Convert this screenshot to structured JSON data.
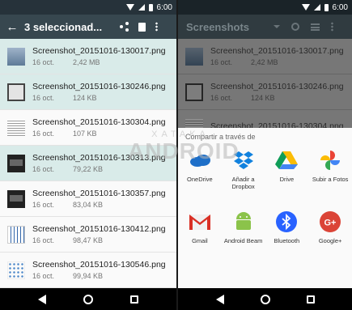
{
  "status": {
    "time": "6:00"
  },
  "left": {
    "toolbar": {
      "title": "3 seleccionad..."
    },
    "files": [
      {
        "name": "Screenshot_20151016-130017.png",
        "date": "16 oct.",
        "size": "2,42 MB",
        "selected": true,
        "thumb": "t-blue"
      },
      {
        "name": "Screenshot_20151016-130246.png",
        "date": "16 oct.",
        "size": "124 KB",
        "selected": true,
        "thumb": "t-frame"
      },
      {
        "name": "Screenshot_20151016-130304.png",
        "date": "16 oct.",
        "size": "107 KB",
        "selected": false,
        "thumb": "t-text"
      },
      {
        "name": "Screenshot_20151016-130313.png",
        "date": "16 oct.",
        "size": "79,22 KB",
        "selected": true,
        "thumb": "t-dark"
      },
      {
        "name": "Screenshot_20151016-130357.png",
        "date": "16 oct.",
        "size": "83,04 KB",
        "selected": false,
        "thumb": "t-dark"
      },
      {
        "name": "Screenshot_20151016-130412.png",
        "date": "16 oct.",
        "size": "98,47 KB",
        "selected": false,
        "thumb": "t-grid"
      },
      {
        "name": "Screenshot_20151016-130546.png",
        "date": "16 oct.",
        "size": "99,94 KB",
        "selected": false,
        "thumb": "t-dots"
      }
    ]
  },
  "right": {
    "toolbar": {
      "title": "Screenshots"
    },
    "files": [
      {
        "name": "Screenshot_20151016-130017.png",
        "date": "16 oct.",
        "size": "2,42 MB",
        "thumb": "t-blue"
      },
      {
        "name": "Screenshot_20151016-130246.png",
        "date": "16 oct.",
        "size": "124 KB",
        "thumb": "t-frame"
      },
      {
        "name": "Screenshot_20151016-130304.png",
        "date": "",
        "size": "",
        "thumb": "t-text"
      }
    ],
    "share": {
      "title": "Compartir a través de",
      "apps": [
        {
          "label": "OneDrive",
          "icon": "onedrive-icon",
          "color": "#1e6fc8"
        },
        {
          "label": "Añadir a Dropbox",
          "icon": "dropbox-icon",
          "color": "#1081de"
        },
        {
          "label": "Drive",
          "icon": "drive-icon",
          "color": "#fbbc05"
        },
        {
          "label": "Subir a Fotos",
          "icon": "photos-icon",
          "color": "#ea4335"
        },
        {
          "label": "Gmail",
          "icon": "gmail-icon",
          "color": "#d93025"
        },
        {
          "label": "Android Beam",
          "icon": "android-beam-icon",
          "color": "#8bc34a"
        },
        {
          "label": "Bluetooth",
          "icon": "bluetooth-icon",
          "color": "#2962ff"
        },
        {
          "label": "Google+",
          "icon": "google-plus-icon",
          "color": "#db4437"
        }
      ]
    }
  },
  "watermark": {
    "top": "XATAKA",
    "bottom": "ANDROID"
  }
}
